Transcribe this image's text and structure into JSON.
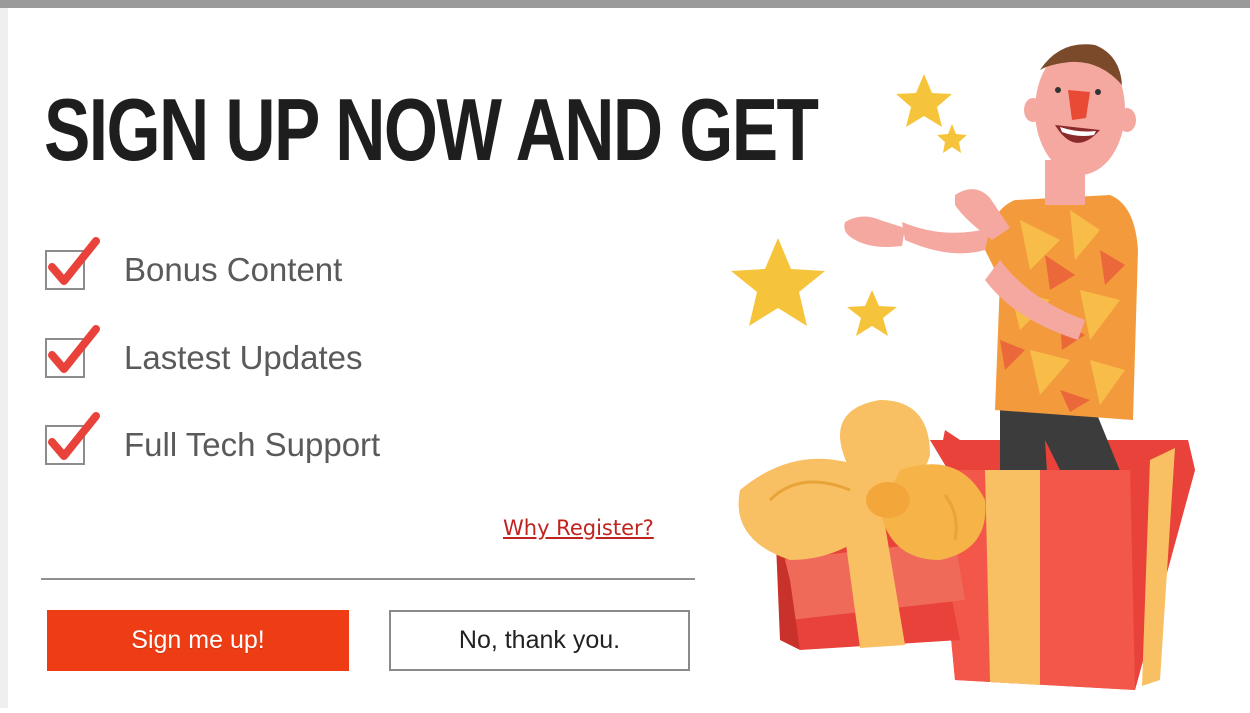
{
  "headline": "SIGN UP NOW AND GET",
  "benefits": [
    {
      "label": "Bonus Content",
      "icon": "checkmark-icon"
    },
    {
      "label": "Lastest Updates",
      "icon": "checkmark-icon"
    },
    {
      "label": "Full Tech Support",
      "icon": "checkmark-icon"
    }
  ],
  "why_link": "Why Register?",
  "buttons": {
    "signup_label": "Sign me up!",
    "decline_label": "No, thank you."
  },
  "colors": {
    "headline": "#1e1e1e",
    "accent": "#ee3d14",
    "check": "#e8423a",
    "link": "#c0231e",
    "divider": "#8f8f8f"
  },
  "illustration": "man-in-gift-box-illustration"
}
